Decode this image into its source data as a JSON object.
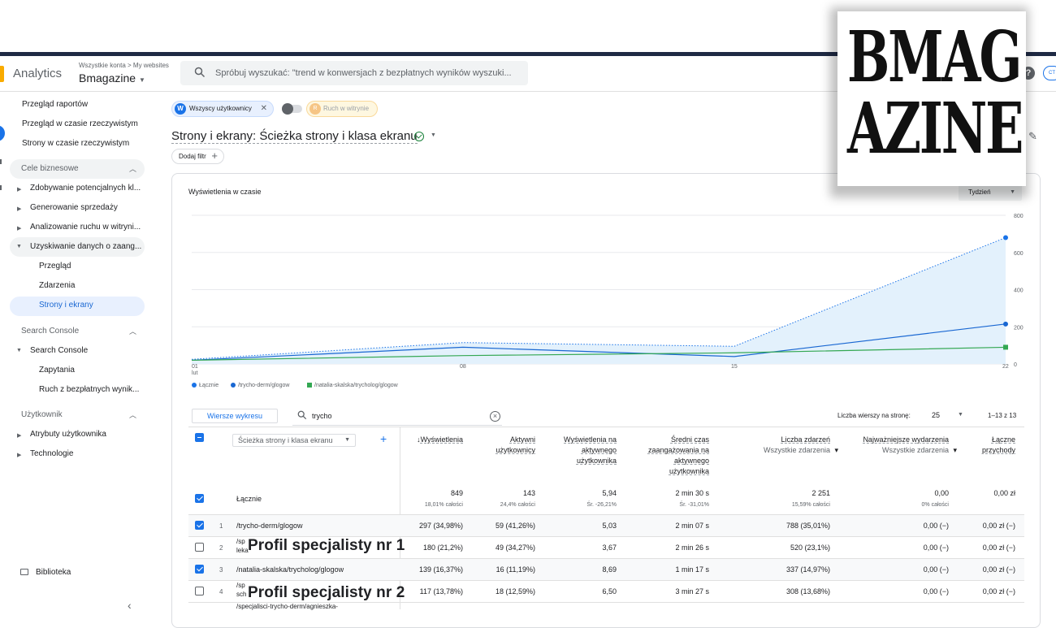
{
  "header": {
    "app_name": "Analytics",
    "breadcrumb": "Wszystkie konta > My websites",
    "account": "Bmagazine",
    "search_placeholder": "Spróbuj wyszukać: \"trend w konwersjach z bezpłatnych wyników wyszuki..."
  },
  "sidebar": {
    "items": [
      "Przegląd raportów",
      "Przegląd w czasie rzeczywistym",
      "Strony w czasie rzeczywistym"
    ],
    "section_business": "Cele biznesowe",
    "business_items": [
      "Zdobywanie potencjalnych kl...",
      "Generowanie sprzedaży",
      "Analizowanie ruchu w witryni...",
      "Uzyskiwanie danych o zaang..."
    ],
    "engagement_children": [
      "Przegląd",
      "Zdarzenia",
      "Strony i ekrany"
    ],
    "section_search": "Search Console",
    "search_parent": "Search Console",
    "search_children": [
      "Zapytania",
      "Ruch z bezpłatnych wynik..."
    ],
    "section_user": "Użytkownik",
    "user_items": [
      "Atrybuty użytkownika",
      "Technologie"
    ],
    "library": "Biblioteka"
  },
  "filters": {
    "chip_all_users": "Wszyscy użytkownicy",
    "chip_all_users_badge": "W",
    "chip_site_traffic": "Ruch w witrynie",
    "chip_site_traffic_badge": "R",
    "add_filter": "Dodaj filtr"
  },
  "report": {
    "title": "Strony i ekrany: Ścieżka strony i klasa ekranu"
  },
  "chart_data": {
    "type": "line",
    "title": "Wyświetlenia w czasie",
    "granularity": "Tydzień",
    "x": [
      "01 lut",
      "08",
      "15",
      "22"
    ],
    "x_ticks": [
      "01",
      "08",
      "15",
      "22"
    ],
    "x_month": "lut",
    "y_ticks": [
      "0",
      "200",
      "400",
      "600",
      "800"
    ],
    "ylim": [
      0,
      800
    ],
    "series": [
      {
        "name": "Łącznie",
        "values": [
          25,
          115,
          95,
          680
        ],
        "color": "#1a73e8",
        "style": "dotted-area"
      },
      {
        "name": "/trycho-derm/glogow",
        "values": [
          20,
          90,
          40,
          215
        ],
        "color": "#1967d2",
        "style": "line"
      },
      {
        "name": "/natalia-skalska/trycholog/glogow",
        "values": [
          20,
          45,
          60,
          90
        ],
        "color": "#34a853",
        "style": "line"
      }
    ]
  },
  "table": {
    "plot_rows_btn": "Wiersze wykresu",
    "search_value": "trycho",
    "rows_per_page_label": "Liczba wierszy na stronę:",
    "rows_per_page": "25",
    "range": "1–13 z 13",
    "dim_header": "Ścieżka strony i klasa ekranu",
    "columns": [
      {
        "l1": "Wyświetlenia",
        "l2": "",
        "l3": "",
        "l4": "",
        "sorted": true
      },
      {
        "l1": "Aktywni",
        "l2": "użytkownicy",
        "l3": "",
        "l4": ""
      },
      {
        "l1": "Wyświetlenia na",
        "l2": "aktywnego",
        "l3": "użytkownika",
        "l4": ""
      },
      {
        "l1": "Średni czas",
        "l2": "zaangażowania na",
        "l3": "aktywnego",
        "l4": "użytkownika"
      },
      {
        "l1": "Liczba zdarzeń",
        "l2": "Wszystkie zdarzenia",
        "l3": "",
        "l4": ""
      },
      {
        "l1": "Najważniejsze wydarzenia",
        "l2": "Wszystkie zdarzenia",
        "l3": "",
        "l4": ""
      },
      {
        "l1": "Łączne",
        "l2": "przychody",
        "l3": "",
        "l4": ""
      }
    ],
    "total": {
      "label": "Łącznie",
      "values": [
        "849",
        "143",
        "5,94",
        "2 min 30 s",
        "2 251",
        "0,00",
        "0,00 zł"
      ],
      "subs": [
        "18,01% całości",
        "24,4% całości",
        "Śr. -26,21%",
        "Śr. -31,01%",
        "15,59% całości",
        "0% całości",
        ""
      ]
    },
    "rows": [
      {
        "num": "1",
        "checked": true,
        "path": "/trycho-derm/glogow",
        "path2": "",
        "values": [
          "297 (34,98%)",
          "59 (41,26%)",
          "5,03",
          "2 min 07 s",
          "788 (35,01%)",
          "0,00 (−)",
          "0,00 zł (−)"
        ]
      },
      {
        "num": "2",
        "checked": false,
        "path": "/sp",
        "path2": "leka",
        "values": [
          "180 (21,2%)",
          "49 (34,27%)",
          "3,67",
          "2 min 26 s",
          "520 (23,1%)",
          "0,00 (−)",
          "0,00 zł (−)"
        ]
      },
      {
        "num": "3",
        "checked": true,
        "path": "/natalia-skalska/trycholog/glogow",
        "path2": "",
        "values": [
          "139 (16,37%)",
          "16 (11,19%)",
          "8,69",
          "1 min 17 s",
          "337 (14,97%)",
          "0,00 (−)",
          "0,00 zł (−)"
        ]
      },
      {
        "num": "4",
        "checked": false,
        "path": "/sp",
        "path2": "sch",
        "values": [
          "117 (13,78%)",
          "18 (12,59%)",
          "6,50",
          "3 min 27 s",
          "308 (13,68%)",
          "0,00 (−)",
          "0,00 zł (−)"
        ]
      }
    ],
    "partial_row_path": "/specjalisci-trycho-derm/agnieszka-"
  },
  "overlays": {
    "label1": "Profil specjalisty nr 1",
    "label2": "Profil specjalisty nr 2"
  },
  "brand": {
    "line1": "BMAG",
    "line2": "AZINE"
  }
}
